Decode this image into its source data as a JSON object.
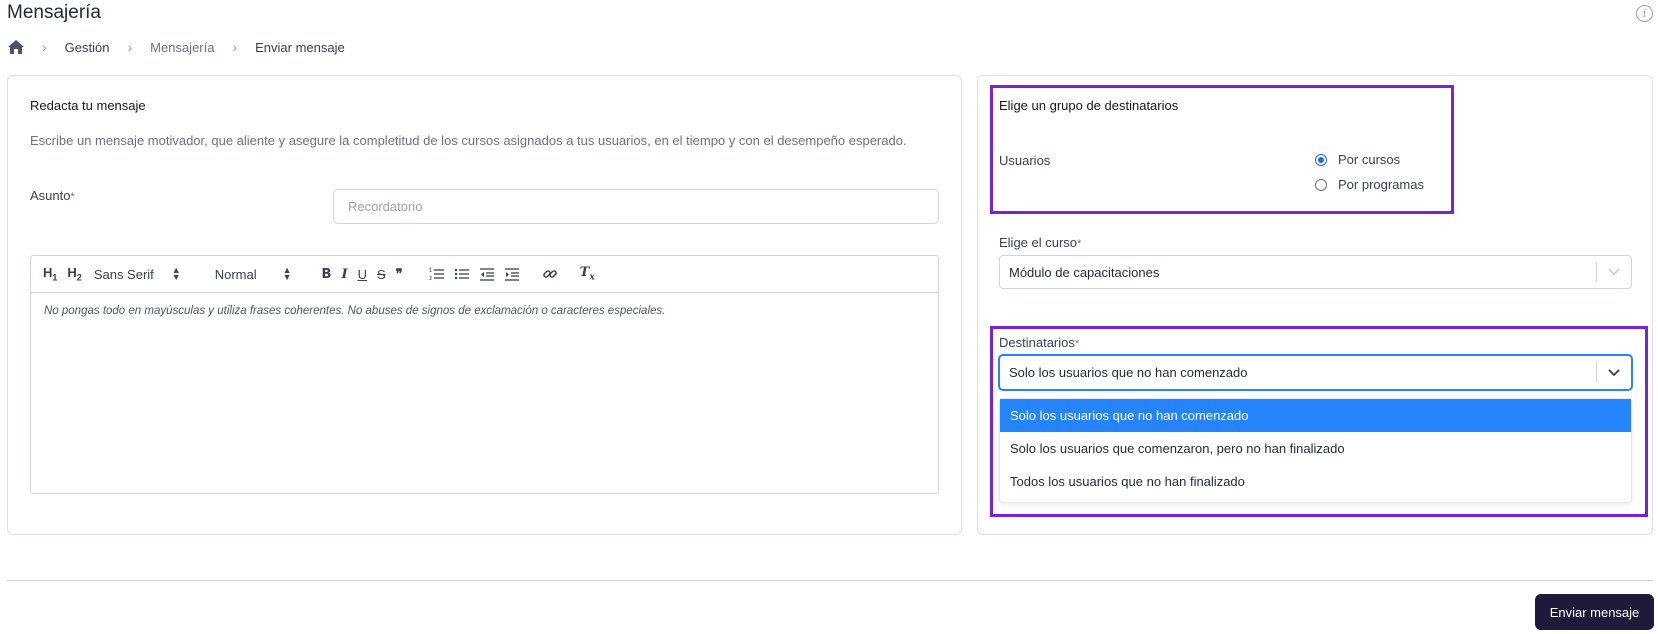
{
  "header": {
    "title": "Mensajería",
    "info_icon": "info-icon"
  },
  "breadcrumb": {
    "home_icon": "home-icon",
    "items": [
      "Gestión",
      "Mensajería",
      "Enviar mensaje"
    ]
  },
  "compose": {
    "title": "Redacta tu mensaje",
    "help": "Escribe un mensaje motivador, que aliente y asegure la completitud de los cursos asignados a tus usuarios, en el tiempo y con el desempeño esperado.",
    "subject_label": "Asunto",
    "required_mark": "*",
    "subject_placeholder": "Recordatorio",
    "subject_value": "",
    "toolbar": {
      "h1": "H",
      "h1_sub": "1",
      "h2": "H",
      "h2_sub": "2",
      "font": "Sans Serif",
      "size": "Normal",
      "bold": "B",
      "italic": "I",
      "underline": "U",
      "strike": "S",
      "quote": "❞",
      "clean": "T"
    },
    "editor_placeholder": "No pongas todo en mayúsculas y utiliza frases coherentes. No abuses de signos de exclamación o caracteres especiales."
  },
  "recipients": {
    "title": "Elige un grupo de destinatarios",
    "users_label": "Usuarios",
    "options": [
      {
        "label": "Por cursos",
        "checked": true
      },
      {
        "label": "Por programas",
        "checked": false
      }
    ],
    "course_label": "Elige el curso",
    "course_value": "Módulo de capacitaciones",
    "dest_label": "Destinatarios",
    "dest_value": "Solo los usuarios que no han comenzado",
    "dest_options": [
      "Solo los usuarios que no han comenzado",
      "Solo los usuarios que comenzaron, pero no han finalizado",
      "Todos los usuarios que no han finalizado"
    ]
  },
  "footer": {
    "send_label": "Enviar mensaje"
  },
  "colors": {
    "highlight": "#7c22d6",
    "selected_option": "#2684ff",
    "primary_button": "#1e1b3a",
    "radio_checked": "#2563eb"
  }
}
